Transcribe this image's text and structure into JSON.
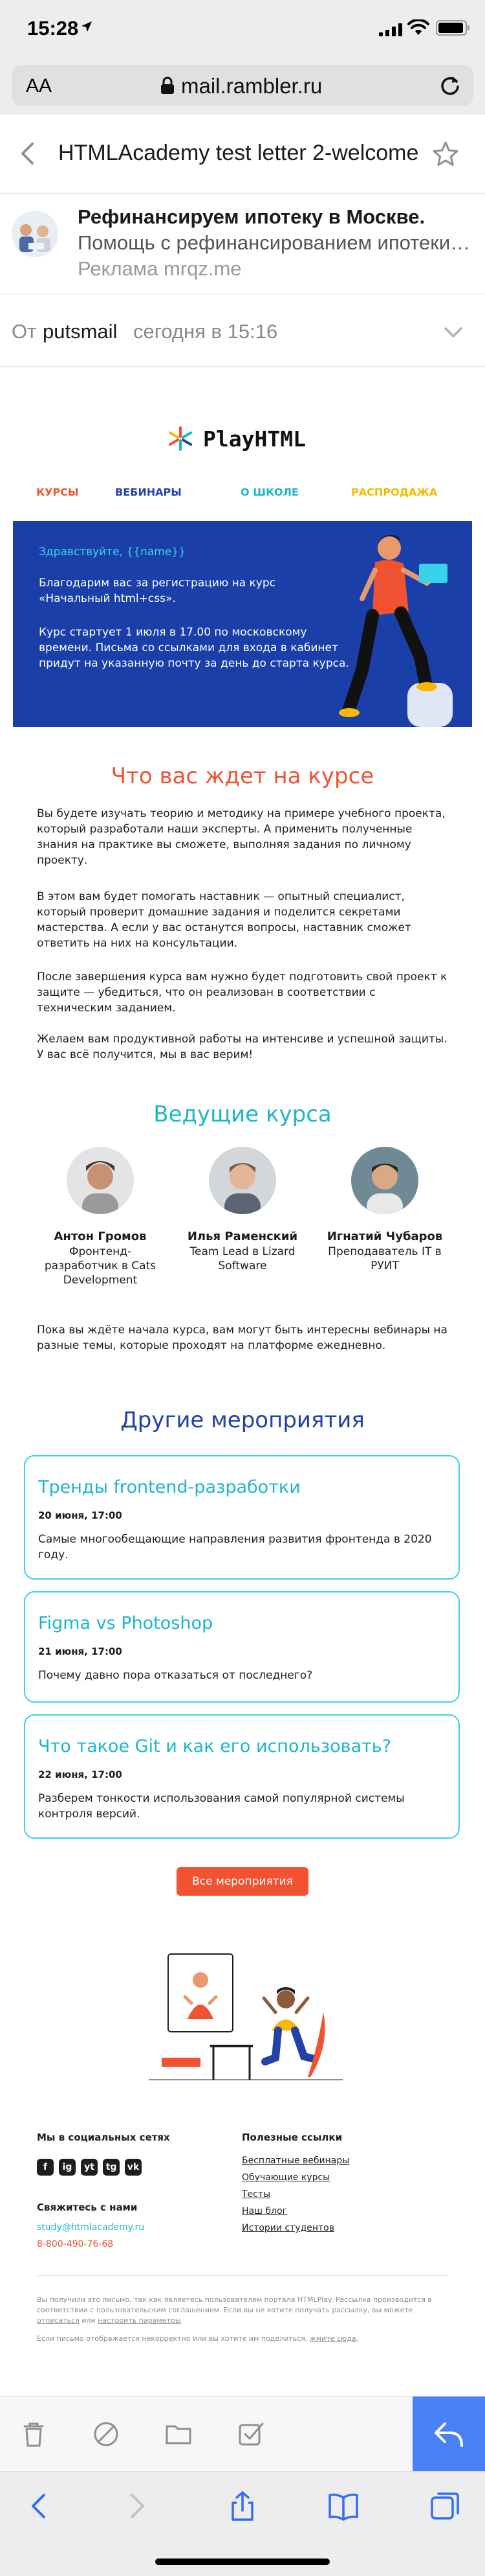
{
  "status_bar": {
    "time": "15:28"
  },
  "browser": {
    "aa_label": "AA",
    "url": "mail.rambler.ru"
  },
  "mail": {
    "subject": "HTMLAcademy test letter 2-welcome",
    "ad": {
      "title": "Рефинансируем ипотеку в Москве.",
      "text": "Помощь с рефинансированием ипотеки. Выгодные условия",
      "label": "Реклама mrqz.me"
    },
    "from_label": "От",
    "from_name": "putsmail",
    "date": "сегодня в 15:16"
  },
  "email": {
    "logo_text": "PlayHTML",
    "nav": {
      "courses": "КУРСЫ",
      "webinars": "ВЕБИНАРЫ",
      "school": "О ШКОЛЕ",
      "sale": "РАСПРОДАЖА"
    },
    "hero": {
      "greeting": "Здравствуйте, {{name}}",
      "p1": "Благодарим вас за регистрацию на курс «Начальный html+css».",
      "p2": "Курс стартует 1 июля в 17.00 по московскому времени. Письма со ссылками для входа в кабинет придут на указанную почту за день до старта курса."
    },
    "what_heading": "Что вас ждет на курсе",
    "what_p1": "Вы будете изучать теорию и методику на примере учебного проекта, который разработали наши эксперты. А применить полученные знания на практике вы сможете, выполняя задания по личному проекту.",
    "what_p2": "В этом вам будет помогать наставник — опытный специалист, который проверит домашние задания и поделится секретами мастерства. А если у вас останутся вопросы, наставник сможет ответить на них на консультации.",
    "what_p3": "После завершения курса вам нужно будет подготовить свой проект к защите — убедиться, что он реализован в соответствии с техническим заданием.",
    "what_p4": "Желаем вам продуктивной работы на интенсиве и успешной защиты. У вас всё получится, мы в вас верим!",
    "hosts_heading": "Ведущие курса",
    "hosts": [
      {
        "name": "Антон Громов",
        "role": "Фронтенд-разработчик в Cats Development"
      },
      {
        "name": "Илья Раменский",
        "role": "Team Lead в Lizard Software"
      },
      {
        "name": "Игнатий Чубаров",
        "role": "Преподаватель IT в РУИТ"
      }
    ],
    "webinars_note": "Пока вы ждёте начала курса, вам могут быть интересны вебинары на разные темы, которые проходят на платформе ежедневно.",
    "events_heading": "Другие мероприятия",
    "events": [
      {
        "title": "Тренды frontend-разработки",
        "date": "20 июня, 17:00",
        "desc": "Самые многообещающие направления развития фронтенда в 2020 году."
      },
      {
        "title": "Figma vs Photoshop",
        "date": "21 июня, 17:00",
        "desc": "Почему давно пора отказаться от последнего?"
      },
      {
        "title": "Что такое Git и как его использовать?",
        "date": "22 июня, 17:00",
        "desc": "Разберем тонкости использования самой популярной системы контроля версий."
      }
    ],
    "all_events_label": "Все мероприятия",
    "footer": {
      "social_heading": "Мы в социальных сетях",
      "social_icons": [
        "f",
        "ig",
        "yt",
        "tg",
        "vk"
      ],
      "contact_heading": "Свяжитесь с нами",
      "contact_email": "study@htmlacademy.ru",
      "contact_phone": "8-800-490-76-68",
      "links_heading": "Полезные ссылки",
      "links": [
        "Бесплатные вебинары",
        "Обучающие курсы",
        "Тесты",
        "Наш блог",
        "Истории студентов"
      ],
      "fine_print_1_a": "Вы получили это письмо, так как являетесь пользователем портала HTMLPlay. Рассылка производится в соответствии с пользовательским соглашением. Если вы не хотите получать рассылку, вы можете ",
      "fine_print_1_link1": "отписаться",
      "fine_print_1_b": " или ",
      "fine_print_1_link2": "настроить параметры",
      "fine_print_1_c": ".",
      "fine_print_2_a": "Если письмо отображается некорректно или вы хотите им поделиться, ",
      "fine_print_2_link": "жмите сюда",
      "fine_print_2_b": "."
    }
  },
  "colors": {
    "orange": "#f05232",
    "blue": "#2242a8",
    "cyan": "#1cb6c9",
    "yellow": "#f6b800",
    "reply": "#4a7ff5"
  }
}
